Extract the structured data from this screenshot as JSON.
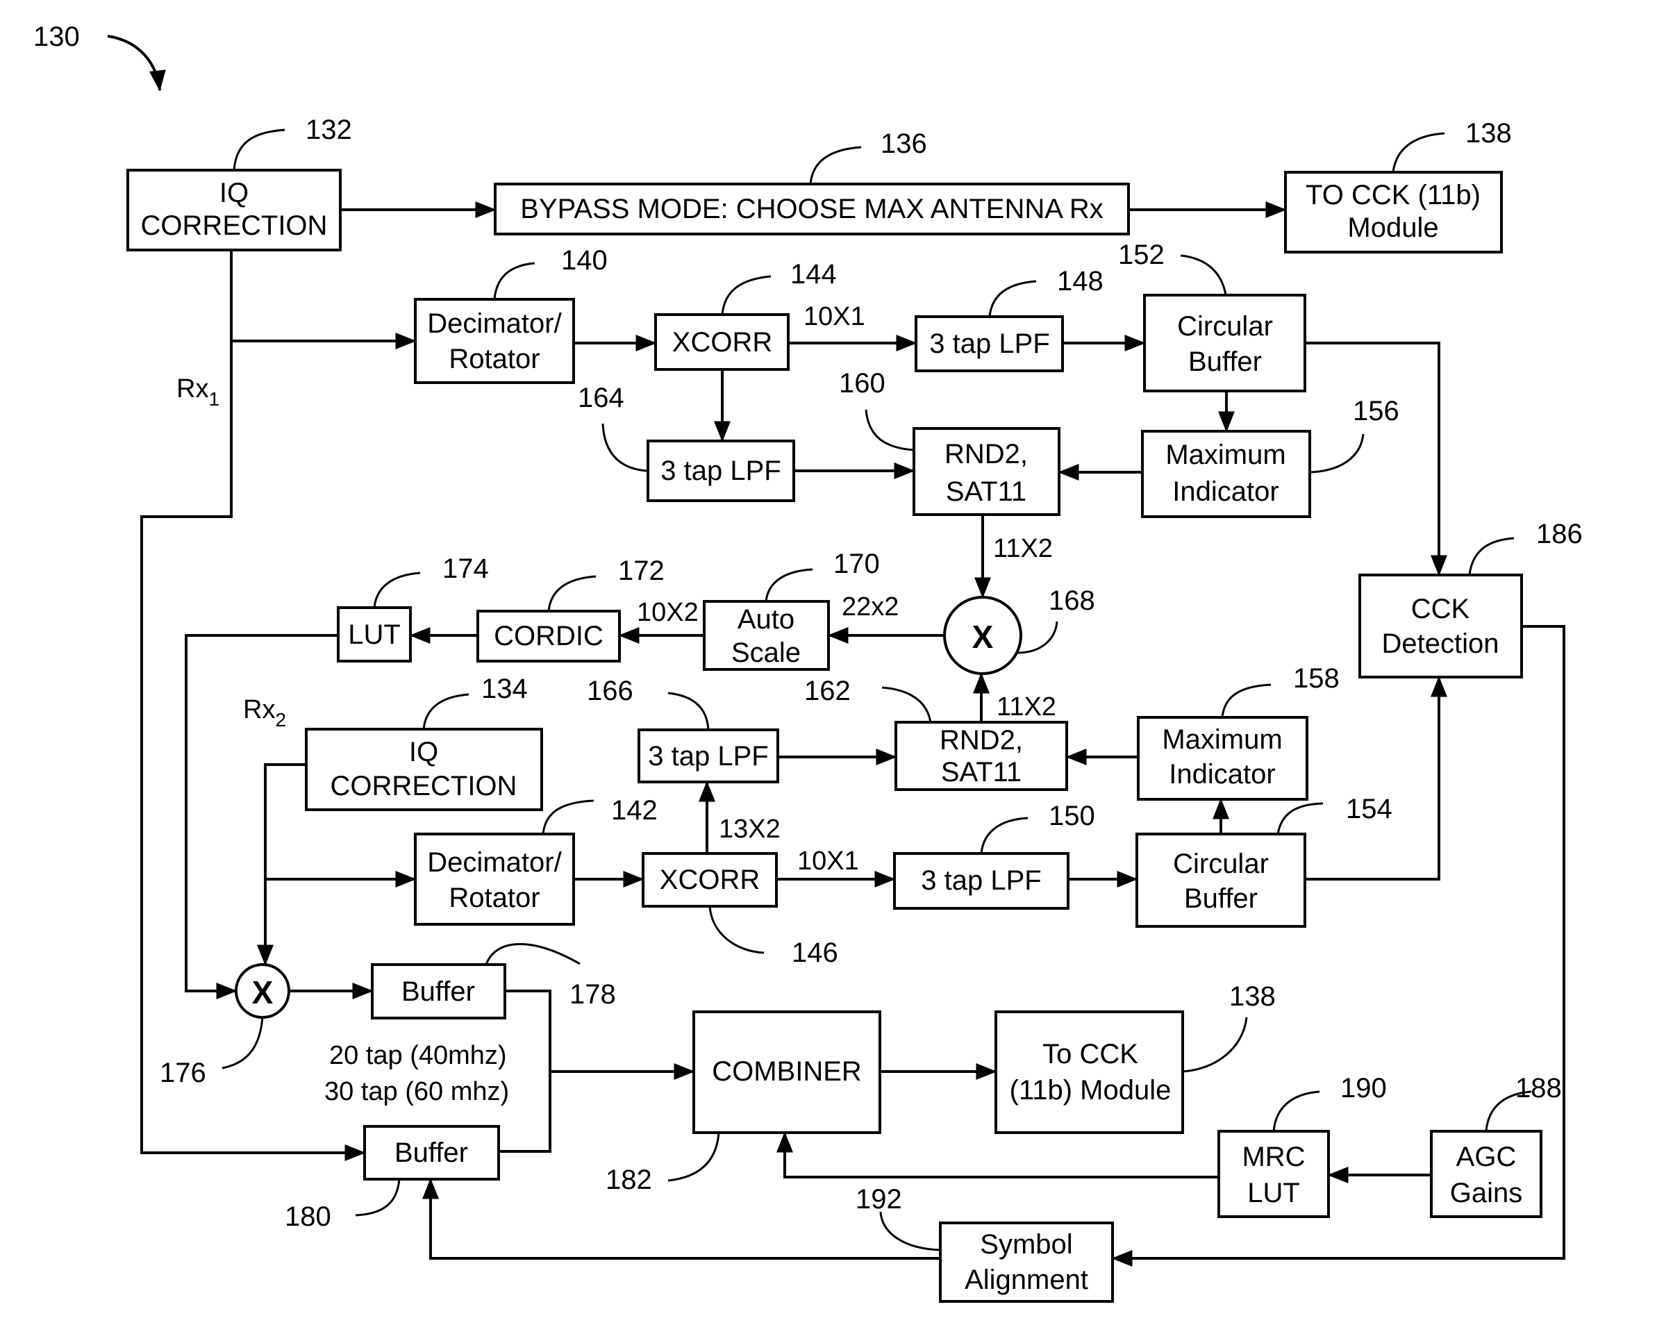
{
  "figure": {
    "ref": "130",
    "blocks": {
      "iq1": {
        "ref": "132",
        "lines": [
          "IQ",
          "CORRECTION"
        ]
      },
      "bypass": {
        "ref": "136",
        "lines": [
          "BYPASS MODE: CHOOSE MAX ANTENNA Rx"
        ]
      },
      "cck_top": {
        "ref": "138",
        "lines": [
          "TO CCK (11b)",
          "Module"
        ]
      },
      "dec1": {
        "ref": "140",
        "lines": [
          "Decimator/",
          "Rotator"
        ]
      },
      "xcorr1": {
        "ref": "144",
        "lines": [
          "XCORR"
        ]
      },
      "lpf148": {
        "ref": "148",
        "lines": [
          "3 tap LPF"
        ]
      },
      "circ152": {
        "ref": "152",
        "lines": [
          "Circular",
          "Buffer"
        ]
      },
      "lpf164": {
        "ref": "164",
        "lines": [
          "3 tap LPF"
        ]
      },
      "rnd160": {
        "ref": "160",
        "lines": [
          "RND2,",
          "SAT11"
        ]
      },
      "max156": {
        "ref": "156",
        "lines": [
          "Maximum",
          "Indicator"
        ]
      },
      "cckdet": {
        "ref": "186",
        "lines": [
          "CCK",
          "Detection"
        ]
      },
      "mult168": {
        "ref": "168",
        "symbol": "X"
      },
      "auto170": {
        "ref": "170",
        "lines": [
          "Auto",
          "Scale"
        ]
      },
      "cordic172": {
        "ref": "172",
        "lines": [
          "CORDIC"
        ]
      },
      "lut174": {
        "ref": "174",
        "lines": [
          "LUT"
        ]
      },
      "iq2": {
        "ref": "134",
        "lines": [
          "IQ",
          "CORRECTION"
        ]
      },
      "lpf166": {
        "ref": "166",
        "lines": [
          "3 tap LPF"
        ]
      },
      "rnd162": {
        "ref": "162",
        "lines": [
          "RND2,",
          "SAT11"
        ]
      },
      "max158": {
        "ref": "158",
        "lines": [
          "Maximum",
          "Indicator"
        ]
      },
      "dec2": {
        "ref": "142",
        "lines": [
          "Decimator/",
          "Rotator"
        ]
      },
      "xcorr2": {
        "ref": "146",
        "lines": [
          "XCORR"
        ]
      },
      "lpf150": {
        "ref": "150",
        "lines": [
          "3 tap LPF"
        ]
      },
      "circ154": {
        "ref": "154",
        "lines": [
          "Circular",
          "Buffer"
        ]
      },
      "mult176": {
        "ref": "176",
        "symbol": "X"
      },
      "buf178": {
        "ref": "178",
        "lines": [
          "Buffer"
        ]
      },
      "buf180": {
        "ref": "180",
        "lines": [
          "Buffer"
        ]
      },
      "combiner": {
        "ref": "182",
        "lines": [
          "COMBINER"
        ]
      },
      "cck_bottom": {
        "ref": "138",
        "lines": [
          "To CCK",
          "(11b) Module"
        ]
      },
      "mrc": {
        "ref": "190",
        "lines": [
          "MRC",
          "LUT"
        ]
      },
      "agc": {
        "ref": "188",
        "lines": [
          "AGC",
          "Gains"
        ]
      },
      "symalign": {
        "ref": "192",
        "lines": [
          "Symbol",
          "Alignment"
        ]
      }
    },
    "signals": {
      "rx1": "Rx",
      "rx1_sub": "1",
      "rx2": "Rx",
      "rx2_sub": "2",
      "xcorr1_out": "10X1",
      "rnd160_out": "11X2",
      "mult_out": "22x2",
      "cordic_in": "10X2",
      "rnd162_out": "11X2",
      "xcorr2_up": "13X2",
      "xcorr2_out": "10X1",
      "tap_note_1": "20 tap (40mhz)",
      "tap_note_2": "30 tap (60 mhz)"
    }
  }
}
